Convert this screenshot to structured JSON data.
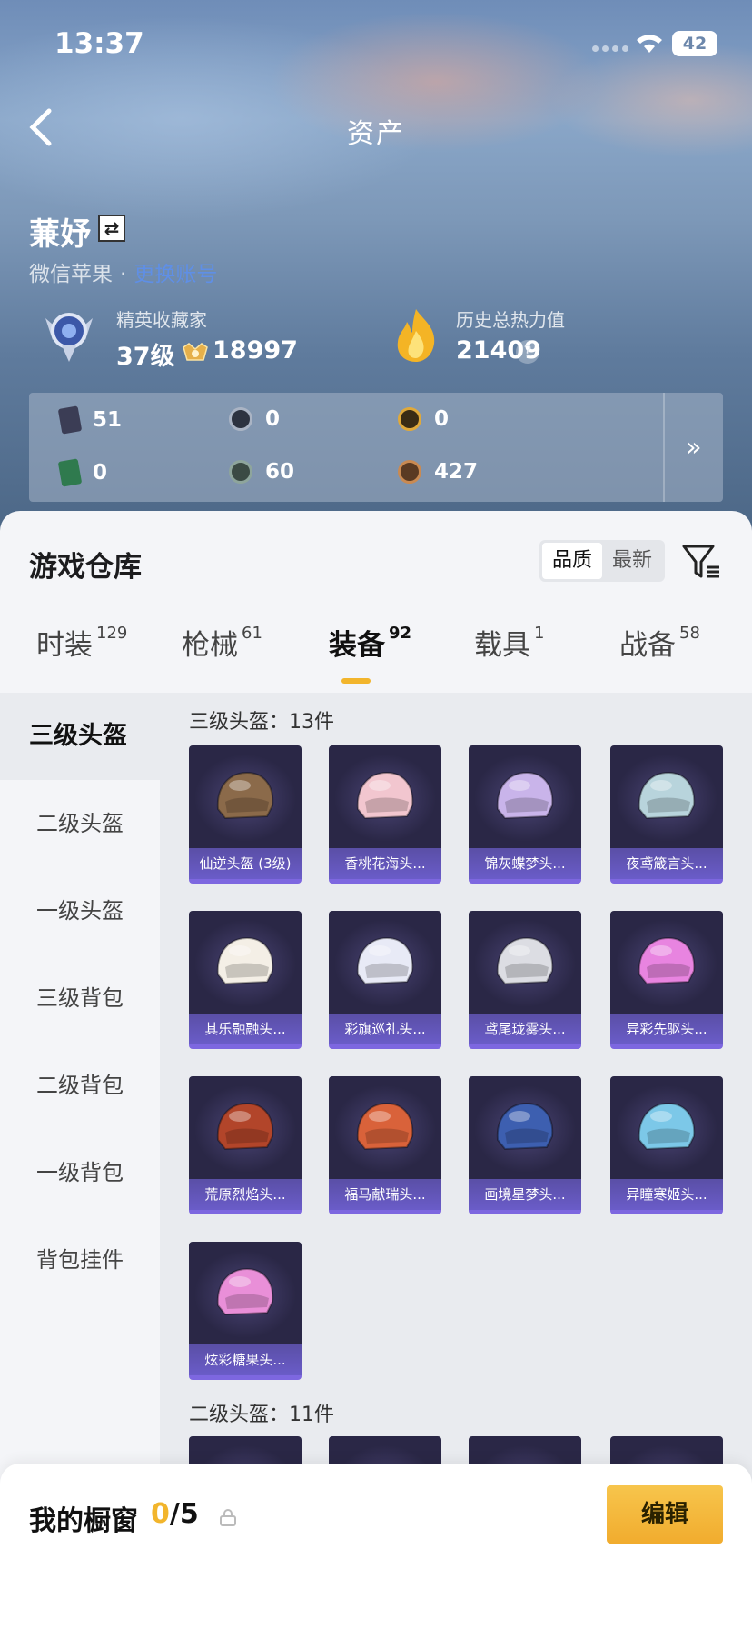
{
  "status_bar": {
    "time": "13:37",
    "battery": "42"
  },
  "nav": {
    "title": "资产"
  },
  "profile": {
    "name": "蒹妤",
    "platform": "微信苹果",
    "platform_link": "更换账号"
  },
  "stats": {
    "rank_label": "精英收藏家",
    "rank_level": "37级",
    "coins": "18997",
    "heat_label": "历史总热力值",
    "heat_value": "21409",
    "help": "?"
  },
  "resources": [
    {
      "icon": "card-dark-icon",
      "value": "51"
    },
    {
      "icon": "silver-coin-icon",
      "value": "0"
    },
    {
      "icon": "gold-coin-icon",
      "value": "0"
    },
    {
      "icon": "card-green-icon",
      "value": "0"
    },
    {
      "icon": "green-coin-icon",
      "value": "60"
    },
    {
      "icon": "bronze-coin-icon",
      "value": "427"
    }
  ],
  "resources_more": "»",
  "warehouse": {
    "title": "游戏仓库",
    "sort": [
      "品质",
      "最新"
    ],
    "tabs": [
      {
        "label": "时装",
        "count": "129"
      },
      {
        "label": "枪械",
        "count": "61"
      },
      {
        "label": "装备",
        "count": "92"
      },
      {
        "label": "载具",
        "count": "1"
      },
      {
        "label": "战备",
        "count": "58"
      }
    ]
  },
  "sidebar": [
    "三级头盔",
    "二级头盔",
    "一级头盔",
    "三级背包",
    "二级背包",
    "一级背包",
    "背包挂件"
  ],
  "section1": {
    "title": "三级头盔：13件",
    "items": [
      "仙逆头盔 (3级)",
      "香桃花海头...",
      "锦灰蝶梦头...",
      "夜鸢箴言头...",
      "其乐融融头...",
      "彩旗巡礼头...",
      "鸢尾珑雾头...",
      "异彩先驱头...",
      "荒原烈焰头...",
      "福马献瑞头...",
      "画境星梦头...",
      "异瞳寒姬头...",
      "炫彩糖果头..."
    ],
    "helmet_colors": [
      "#8b6a4a",
      "#f2c6cf",
      "#c9b4ea",
      "#b8d4dc",
      "#f4efe6",
      "#e8eaf6",
      "#dcdde3",
      "#e884e0",
      "#b2452a",
      "#d9623a",
      "#3d5fb0",
      "#7cc8e8",
      "#e98fd8"
    ]
  },
  "section2": {
    "title": "二级头盔：11件"
  },
  "bottom": {
    "label": "我的橱窗",
    "current": "0",
    "total": "/5",
    "edit": "编辑"
  }
}
